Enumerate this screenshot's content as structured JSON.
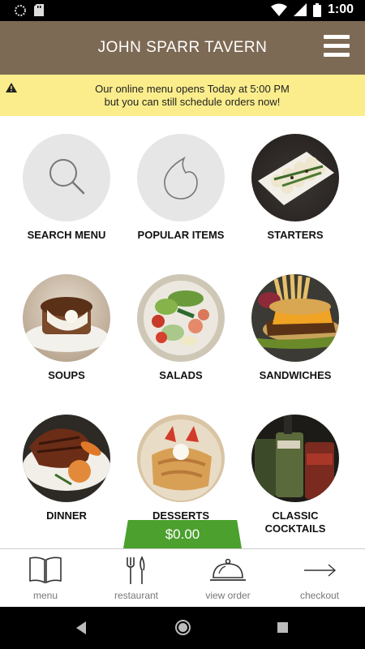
{
  "status_bar": {
    "time": "1:00"
  },
  "header": {
    "title": "JOHN SPARR TAVERN"
  },
  "banner": {
    "line1": "Our online menu opens Today at 5:00 PM",
    "line2": "but you can still schedule orders now!"
  },
  "menu_tiles": [
    {
      "label": "SEARCH MENU",
      "icon": "search-icon"
    },
    {
      "label": "POPULAR ITEMS",
      "icon": "flame-icon"
    },
    {
      "label": "STARTERS",
      "icon": "starters-photo"
    },
    {
      "label": "SOUPS",
      "icon": "soups-photo"
    },
    {
      "label": "SALADS",
      "icon": "salads-photo"
    },
    {
      "label": "SANDWICHES",
      "icon": "sandwiches-photo"
    },
    {
      "label": "DINNER",
      "icon": "dinner-photo"
    },
    {
      "label": "DESSERTS",
      "icon": "desserts-photo"
    },
    {
      "label_line1": "CLASSIC",
      "label_line2": "COCKTAILS",
      "icon": "cocktails-photo"
    }
  ],
  "cart": {
    "total": "$0.00"
  },
  "bottom_nav": [
    {
      "label": "menu",
      "icon": "book-icon"
    },
    {
      "label": "restaurant",
      "icon": "fork-knife-icon"
    },
    {
      "label": "view order",
      "icon": "cloche-icon"
    },
    {
      "label": "checkout",
      "icon": "arrow-right-icon"
    }
  ],
  "colors": {
    "header_bg": "#7d6a54",
    "banner_bg": "#fbed8c",
    "price_tab_bg": "#4ca02e"
  }
}
